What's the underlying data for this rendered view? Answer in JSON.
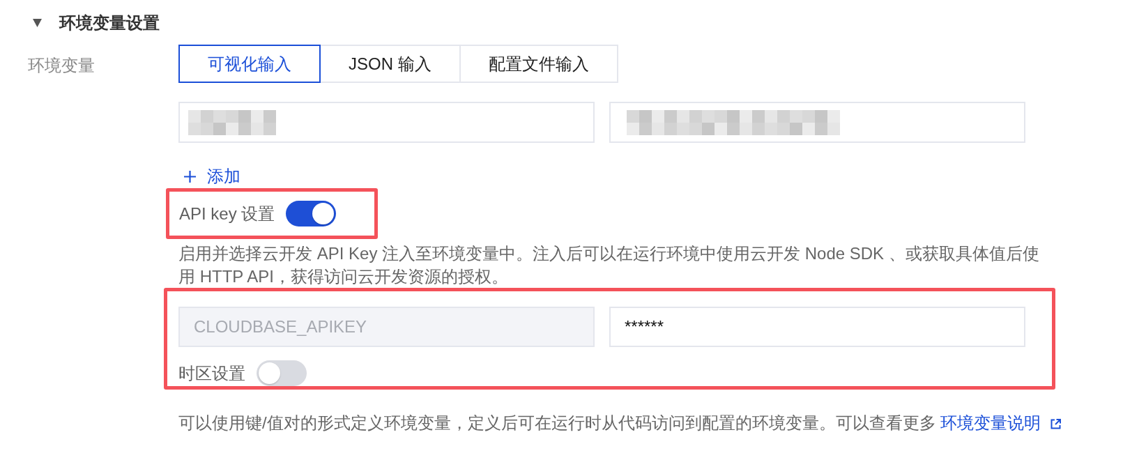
{
  "section": {
    "title": "环境变量设置",
    "expanded": true
  },
  "env_vars": {
    "label": "环境变量",
    "tabs": [
      {
        "label": "可视化输入",
        "selected": true
      },
      {
        "label": "JSON 输入",
        "selected": false
      },
      {
        "label": "配置文件输入",
        "selected": false
      }
    ],
    "fields": [
      {
        "blurred": true
      },
      {
        "blurred": true
      }
    ],
    "add_button": {
      "label": "添加"
    }
  },
  "api_key": {
    "label": "API key 设置",
    "on": true,
    "highlighted": true,
    "description": "启用并选择云开发 API Key 注入至环境变量中。注入后可以在运行环境中使用云开发 Node SDK 、或获取具体值后使用 HTTP API，获得访问云开发资源的授权。"
  },
  "api_key_fields": {
    "highlighted": true,
    "fields": [
      {
        "value": "CLOUDBASE_APIKEY",
        "disabled": true
      },
      {
        "value": "******",
        "disabled": false
      }
    ],
    "timezone": {
      "label": "时区设置",
      "on": false
    }
  },
  "help": {
    "text": "可以使用键/值对的形式定义环境变量，定义后可在运行时从代码访问到配置的环境变量。可以查看更多 ",
    "link": "环境变量说明"
  }
}
